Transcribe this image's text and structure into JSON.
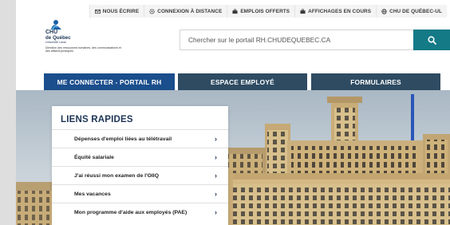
{
  "colors": {
    "brand_navy": "#1d3557",
    "nav_primary": "#1b4e8c",
    "nav_secondary": "#2e4b62",
    "search_button": "#137a86"
  },
  "top_links": [
    {
      "icon": "mail-icon",
      "label": "NOUS ÉCRIRE"
    },
    {
      "icon": "gear-icon",
      "label": "CONNEXION À DISTANCE"
    },
    {
      "icon": "briefcase-icon",
      "label": "EMPLOIS OFFERTS"
    },
    {
      "icon": "briefcase-icon",
      "label": "AFFICHAGES EN COURS"
    },
    {
      "icon": "globe-icon",
      "label": "CHU DE QUÉBEC-UL"
    }
  ],
  "logo": {
    "line1": "CHU",
    "line2": "de Québec",
    "line3": "Université Laval",
    "department": "Direction des ressources humaines, des communications et des affaires juridiques"
  },
  "search": {
    "placeholder": "Chercher sur le portail RH.CHUDEQUEBEC.CA",
    "button_icon": "search-icon"
  },
  "nav": [
    {
      "label": "ME CONNECTER - PORTAIL RH"
    },
    {
      "label": "ESPACE EMPLOYÉ"
    },
    {
      "label": "FORMULAIRES"
    }
  ],
  "quick_links": {
    "title": "LIENS RAPIDES",
    "items": [
      {
        "label": "Dépenses d'emploi liées au télétravail"
      },
      {
        "label": "Équité salariale"
      },
      {
        "label": "J'ai réussi mon examen de l'OIIQ"
      },
      {
        "label": "Mes vacances"
      },
      {
        "label": "Mon programme d'aide aux employés (PAE)"
      }
    ]
  }
}
